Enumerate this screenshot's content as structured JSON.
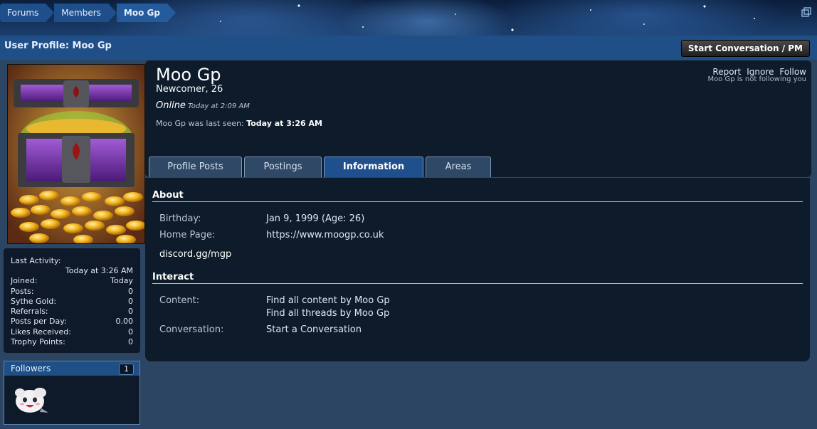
{
  "breadcrumb": [
    "Forums",
    "Members",
    "Moo Gp"
  ],
  "page_title": "User Profile: Moo Gp",
  "start_conversation": "Start Conversation / PM",
  "profile": {
    "name": "Moo Gp",
    "title": "Newcomer, 26",
    "status": "Online",
    "status_time": "Today at 2:09 AM",
    "last_seen_label": "Moo Gp was last seen:",
    "last_seen_value": "Today at 3:26 AM",
    "actions": [
      "Report",
      "Ignore",
      "Follow"
    ],
    "not_following": "Moo Gp is not following you"
  },
  "stats": {
    "last_activity_label": "Last Activity:",
    "last_activity_value": "Today at 3:26 AM",
    "rows": [
      {
        "label": "Joined:",
        "value": "Today"
      },
      {
        "label": "Posts:",
        "value": "0"
      },
      {
        "label": "Sythe Gold:",
        "value": "0"
      },
      {
        "label": "Referrals:",
        "value": "0"
      },
      {
        "label": "Posts per Day:",
        "value": "0.00"
      },
      {
        "label": "Likes Received:",
        "value": "0"
      },
      {
        "label": "Trophy Points:",
        "value": "0"
      }
    ]
  },
  "followers": {
    "label": "Followers",
    "count": "1"
  },
  "tabs": [
    "Profile Posts",
    "Postings",
    "Information",
    "Areas"
  ],
  "about": {
    "title": "About",
    "birthday_label": "Birthday:",
    "birthday_value": "Jan 9, 1999 (Age: 26)",
    "homepage_label": "Home Page:",
    "homepage_value": "https://www.moogp.co.uk",
    "extra": "discord.gg/mgp"
  },
  "interact": {
    "title": "Interact",
    "content_label": "Content:",
    "content_link1": "Find all content by Moo Gp",
    "content_link2": "Find all threads by Moo Gp",
    "conversation_label": "Conversation:",
    "conversation_link": "Start a Conversation"
  },
  "colors": {
    "accent": "#1f4f8c",
    "panel": "#0d1b2b",
    "page_bg": "#2c4563"
  }
}
